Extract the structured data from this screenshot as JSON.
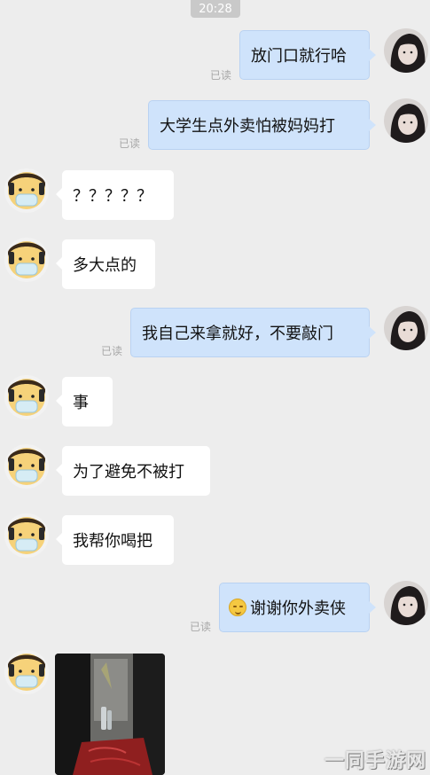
{
  "status": {
    "time": "20:28"
  },
  "chat": {
    "read_label": "已读",
    "messages": [
      {
        "side": "right",
        "text": "放门口就行哈",
        "read": "已读"
      },
      {
        "side": "right",
        "text": "大学生点外卖怕被妈妈打",
        "read": "已读"
      },
      {
        "side": "left",
        "text": "？？？？？"
      },
      {
        "side": "left",
        "text": "多大点的"
      },
      {
        "side": "right",
        "text": "我自己来拿就好，不要敲门",
        "read": "已读"
      },
      {
        "side": "left",
        "text": "事"
      },
      {
        "side": "left",
        "text": "为了避免不被打"
      },
      {
        "side": "left",
        "text": "我帮你喝把"
      },
      {
        "side": "right",
        "text": "谢谢你外卖侠",
        "read": "已读",
        "emoji": "smiling-face-emoji"
      },
      {
        "side": "left",
        "type": "image"
      }
    ]
  },
  "watermark": "一同手游网",
  "colors": {
    "background": "#ededed",
    "self_bubble": "#cfe3fb",
    "other_bubble": "#ffffff"
  }
}
